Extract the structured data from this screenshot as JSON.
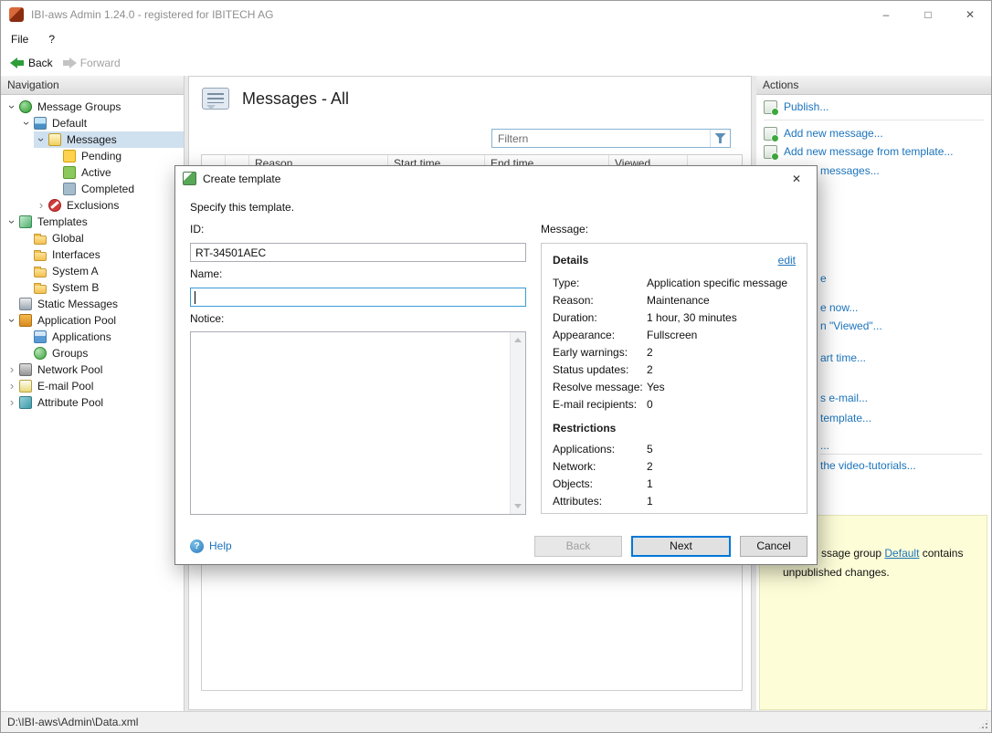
{
  "window": {
    "title": "IBI-aws Admin 1.24.0 - registered for IBITECH AG",
    "minimize_glyph": "–",
    "maximize_glyph": "□",
    "close_glyph": "✕"
  },
  "menu": {
    "file": "File",
    "help": "?"
  },
  "toolbar": {
    "back": "Back",
    "forward": "Forward"
  },
  "navigation": {
    "header": "Navigation",
    "items": [
      {
        "label": "Message Groups",
        "icon": "message-groups-icon",
        "state": "expanded"
      },
      {
        "label": "Default",
        "icon": "message-group-icon",
        "state": "expanded"
      },
      {
        "label": "Messages",
        "icon": "messages-icon",
        "state": "expanded",
        "selected": true
      },
      {
        "label": "Pending",
        "icon": "pending-icon",
        "state": "leaf"
      },
      {
        "label": "Active",
        "icon": "active-icon",
        "state": "leaf"
      },
      {
        "label": "Completed",
        "icon": "completed-icon",
        "state": "leaf"
      },
      {
        "label": "Exclusions",
        "icon": "exclusions-icon",
        "state": "collapsed"
      },
      {
        "label": "Templates",
        "icon": "templates-icon",
        "state": "expanded"
      },
      {
        "label": "Global",
        "icon": "folder-icon",
        "state": "leaf"
      },
      {
        "label": "Interfaces",
        "icon": "folder-icon",
        "state": "leaf"
      },
      {
        "label": "System A",
        "icon": "folder-icon",
        "state": "leaf"
      },
      {
        "label": "System B",
        "icon": "folder-icon",
        "state": "leaf"
      },
      {
        "label": "Static Messages",
        "icon": "static-messages-icon",
        "state": "leaf"
      },
      {
        "label": "Application Pool",
        "icon": "application-pool-icon",
        "state": "expanded"
      },
      {
        "label": "Applications",
        "icon": "applications-icon",
        "state": "leaf"
      },
      {
        "label": "Groups",
        "icon": "groups-icon",
        "state": "leaf"
      },
      {
        "label": "Network Pool",
        "icon": "network-pool-icon",
        "state": "collapsed"
      },
      {
        "label": "E-mail Pool",
        "icon": "email-pool-icon",
        "state": "collapsed"
      },
      {
        "label": "Attribute Pool",
        "icon": "attribute-pool-icon",
        "state": "collapsed"
      }
    ]
  },
  "main": {
    "title": "Messages - All",
    "filter_placeholder": "Filtern",
    "columns": [
      "Reason",
      "Start time",
      "End time",
      "Viewed"
    ]
  },
  "actions": {
    "header": "Actions",
    "links": [
      "Publish...",
      "Add new message...",
      "Add new message from template..."
    ],
    "fragments": [
      "messages...",
      "e",
      "e now...",
      "n \"Viewed\"...",
      "art time...",
      "s e-mail...",
      "template...",
      "...",
      "the video-tutorials..."
    ],
    "notification": {
      "line1_prefix": "ssage group ",
      "line1_link": "Default",
      "line1_suffix": " contains",
      "line2": "unpublished changes."
    }
  },
  "dialog": {
    "title": "Create template",
    "close_glyph": "✕",
    "instruction": "Specify this template.",
    "fields": {
      "id_label": "ID:",
      "id_value": "RT-34501AEC",
      "name_label": "Name:",
      "notice_label": "Notice:"
    },
    "message_section": {
      "label": "Message:",
      "details_header": "Details",
      "edit_link": "edit",
      "details_rows": [
        {
          "label": "Type:",
          "value": "Application specific message"
        },
        {
          "label": "Reason:",
          "value": "Maintenance"
        },
        {
          "label": "Duration:",
          "value": "1 hour, 30 minutes"
        },
        {
          "label": "Appearance:",
          "value": "Fullscreen"
        },
        {
          "label": "Early warnings:",
          "value": "2"
        },
        {
          "label": "Status updates:",
          "value": "2"
        },
        {
          "label": "Resolve message:",
          "value": "Yes"
        },
        {
          "label": "E-mail recipients:",
          "value": "0"
        }
      ],
      "restrictions_header": "Restrictions",
      "restrictions_rows": [
        {
          "label": "Applications:",
          "value": "5"
        },
        {
          "label": "Network:",
          "value": "2"
        },
        {
          "label": "Objects:",
          "value": "1"
        },
        {
          "label": "Attributes:",
          "value": "1"
        }
      ]
    },
    "footer": {
      "help_label": "Help",
      "back_label": "Back",
      "next_label": "Next",
      "cancel_label": "Cancel"
    }
  },
  "statusbar": {
    "path": "D:\\IBI-aws\\Admin\\Data.xml"
  }
}
